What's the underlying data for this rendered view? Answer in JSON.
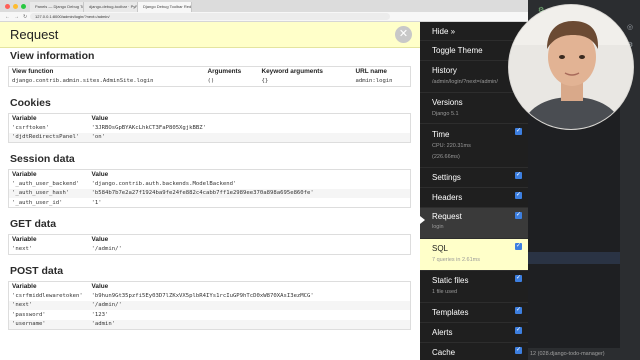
{
  "browser": {
    "tabs": [
      {
        "title": "Panels — Django Debug Toolbar"
      },
      {
        "title": "django-debug-toolbar · PyPI"
      },
      {
        "title": "Django Debug Toolbar Redir..."
      }
    ],
    "url": "127.0.0.1:8000/admin/login/?next=/admin/"
  },
  "page": {
    "title": "Request",
    "close_label": "✕",
    "view": {
      "title": "View information",
      "headers": [
        "View function",
        "Arguments",
        "Keyword arguments",
        "URL name"
      ],
      "row": [
        "django.contrib.admin.sites.AdminSite.login",
        "()",
        "{}",
        "admin:login"
      ]
    },
    "cookies": {
      "title": "Cookies",
      "headers": [
        "Variable",
        "Value"
      ],
      "rows": [
        [
          "'csrftoken'",
          "'3JRBOsGpBYAKcLhkCT3FaP805XgjkBBZ'"
        ],
        [
          "'djdtRedirectsPanel'",
          "'on'"
        ]
      ]
    },
    "session": {
      "title": "Session data",
      "headers": [
        "Variable",
        "Value"
      ],
      "rows": [
        [
          "'_auth_user_backend'",
          "'django.contrib.auth.backends.ModelBackend'"
        ],
        [
          "'_auth_user_hash'",
          "'b584b7b7e2a27f1924ba9fe24fe882c4cabb7ff1e2989ee370a898a695e860fe'"
        ],
        [
          "'_auth_user_id'",
          "'1'"
        ]
      ]
    },
    "get": {
      "title": "GET data",
      "headers": [
        "Variable",
        "Value"
      ],
      "rows": [
        [
          "'next'",
          "'/admin/'"
        ]
      ]
    },
    "post": {
      "title": "POST data",
      "headers": [
        "Variable",
        "Value"
      ],
      "rows": [
        [
          "'csrfmiddlewaretoken'",
          "'b9hun9Gt35pzfi5Ey03D7lZKxVX5plbR4IYs1rcIuGP9hTcD0xW870XAsI3ezMCG'"
        ],
        [
          "'next'",
          "'/admin/'"
        ],
        [
          "'password'",
          "'123'"
        ],
        [
          "'username'",
          "'admin'"
        ]
      ]
    }
  },
  "toolbar": {
    "items": [
      {
        "label": "Hide »",
        "sub": "",
        "check": false
      },
      {
        "label": "Toggle Theme",
        "sub": "",
        "check": false
      },
      {
        "label": "History",
        "sub": "/admin/login/?next=/admin/",
        "check": false
      },
      {
        "label": "Versions",
        "sub": "Django 5.1",
        "check": false
      },
      {
        "label": "Time",
        "sub": "CPU: 220.31ms",
        "sub2": "(226.66ms)",
        "check": true
      },
      {
        "label": "Settings",
        "sub": "",
        "check": true
      },
      {
        "label": "Headers",
        "sub": "",
        "check": true
      },
      {
        "label": "Request",
        "sub": "login",
        "check": true
      },
      {
        "label": "SQL",
        "sub": "7 queries in 2.61ms",
        "check": true
      },
      {
        "label": "Static files",
        "sub": "1 file used",
        "check": true
      },
      {
        "label": "Templates",
        "sub": "",
        "check": true
      },
      {
        "label": "Alerts",
        "sub": "",
        "check": true
      },
      {
        "label": "Cache",
        "sub": "",
        "check": true
      }
    ]
  },
  "ide": {
    "status_text": "12 (028.django-todo-manager)"
  },
  "colors": {
    "header_bg": "#ffffc9",
    "toolbar_bg": "#1f1f1f",
    "check_blue": "#3d7fe0"
  }
}
